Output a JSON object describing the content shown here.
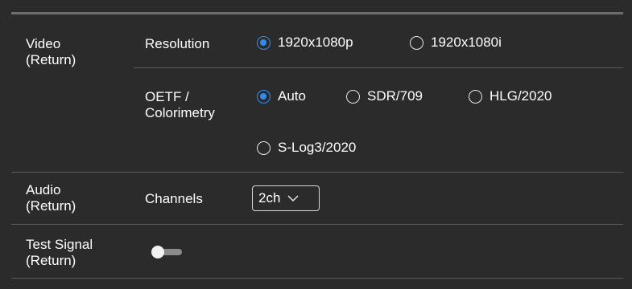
{
  "video": {
    "section_label": "Video\n(Return)",
    "resolution": {
      "label": "Resolution",
      "options": [
        "1920x1080p",
        "1920x1080i"
      ],
      "selected": "1920x1080p"
    },
    "oetf": {
      "label": "OETF /\nColorimetry",
      "options": [
        "Auto",
        "SDR/709",
        "HLG/2020",
        "S-Log3/2020"
      ],
      "selected": "Auto"
    }
  },
  "audio": {
    "section_label": "Audio\n(Return)",
    "channels": {
      "label": "Channels",
      "value": "2ch"
    }
  },
  "test_signal": {
    "section_label": "Test Signal\n(Return)",
    "enabled": false
  },
  "colors": {
    "background": "#2b2b2b",
    "accent": "#2e8ef0",
    "divider": "#5a5a5a",
    "text": "#ffffff"
  }
}
